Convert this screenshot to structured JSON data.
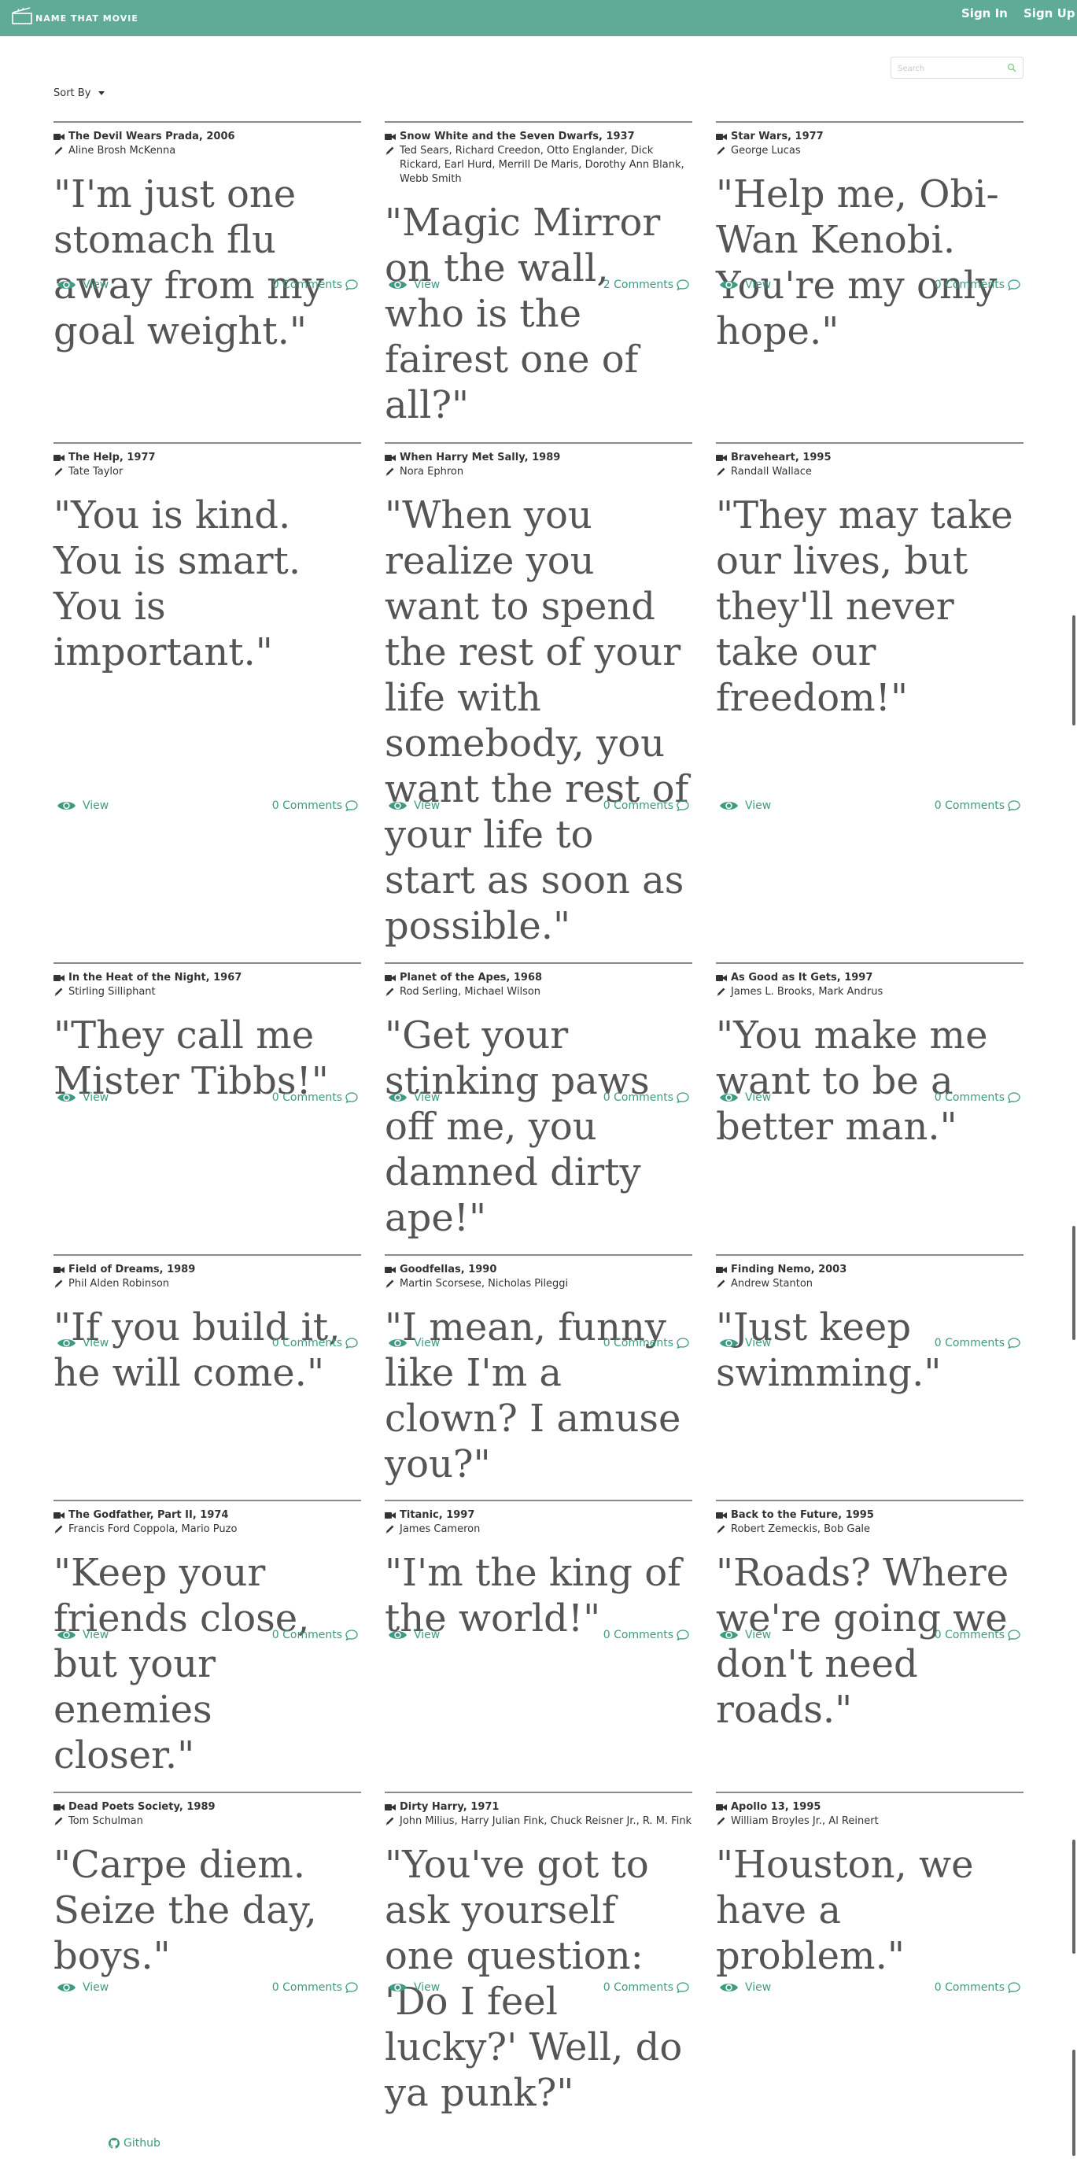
{
  "header": {
    "brand": "NAME THAT MOVIE",
    "sign_in": "Sign In",
    "sign_up": "Sign Up"
  },
  "search": {
    "placeholder": "Search"
  },
  "sort": {
    "label": "Sort By"
  },
  "footer": {
    "github": "Github"
  },
  "colors": {
    "header_bg": "#5fab98",
    "link": "#3e9b82",
    "quote_text": "#555555",
    "divider": "#8a8a8a"
  },
  "movies": [
    {
      "title": "The Devil Wears Prada, 2006",
      "writers": "Aline Brosh McKenna",
      "quote": "\"I'm just one stomach flu away from my goal weight.\"",
      "view": "View",
      "comments": "0 Comments"
    },
    {
      "title": "Snow White and the Seven Dwarfs, 1937",
      "writers": "Ted Sears, Richard Creedon, Otto Englander, Dick Rickard, Earl Hurd, Merrill De Maris, Dorothy Ann Blank, Webb Smith",
      "quote": "\"Magic Mirror on the wall, who is the fairest one of all?\"",
      "view": "View",
      "comments": "2 Comments"
    },
    {
      "title": "Star Wars, 1977",
      "writers": "George Lucas",
      "quote": "\"Help me, Obi-Wan Kenobi. You're my only hope.\"",
      "view": "View",
      "comments": "0 Comments"
    },
    {
      "title": "The Help, 1977",
      "writers": "Tate Taylor",
      "quote": "\"You is kind. You is smart. You is important.\"",
      "view": "View",
      "comments": "0 Comments"
    },
    {
      "title": "When Harry Met Sally, 1989",
      "writers": "Nora Ephron",
      "quote": "\"When you realize you want to spend the rest of your life with somebody, you want the rest of your life to start as soon as possible.\"",
      "view": "View",
      "comments": "0 Comments"
    },
    {
      "title": "Braveheart, 1995",
      "writers": "Randall Wallace",
      "quote": "\"They may take our lives, but they'll never take our freedom!\"",
      "view": "View",
      "comments": "0 Comments"
    },
    {
      "title": "In the Heat of the Night, 1967",
      "writers": "Stirling Silliphant",
      "quote": "\"They call me Mister Tibbs!\"",
      "view": "View",
      "comments": "0 Comments"
    },
    {
      "title": "Planet of the Apes, 1968",
      "writers": "Rod Serling, Michael Wilson",
      "quote": "\"Get your stinking paws off me, you damned dirty ape!\"",
      "view": "View",
      "comments": "0 Comments"
    },
    {
      "title": "As Good as It Gets, 1997",
      "writers": "James L. Brooks, Mark Andrus",
      "quote": "\"You make me want to be a better man.\"",
      "view": "View",
      "comments": "0 Comments"
    },
    {
      "title": "Field of Dreams, 1989",
      "writers": "Phil Alden Robinson",
      "quote": "\"If you build it, he will come.\"",
      "view": "View",
      "comments": "0 Comments"
    },
    {
      "title": "Goodfellas, 1990",
      "writers": "Martin Scorsese, Nicholas Pileggi",
      "quote": "\"I mean, funny like I'm a clown? I amuse you?\"",
      "view": "View",
      "comments": "0 Comments"
    },
    {
      "title": "Finding Nemo, 2003",
      "writers": "Andrew Stanton",
      "quote": "\"Just keep swimming.\"",
      "view": "View",
      "comments": "0 Comments"
    },
    {
      "title": "The Godfather, Part II, 1974",
      "writers": "Francis Ford Coppola, Mario Puzo",
      "quote": "\"Keep your friends close, but your enemies closer.\"",
      "view": "View",
      "comments": "0 Comments"
    },
    {
      "title": "Titanic, 1997",
      "writers": "James Cameron",
      "quote": "\"I'm the king of the world!\"",
      "view": "View",
      "comments": "0 Comments"
    },
    {
      "title": "Back to the Future, 1995",
      "writers": "Robert Zemeckis, Bob Gale",
      "quote": "\"Roads? Where we're going we don't need roads.\"",
      "view": "View",
      "comments": "0 Comments"
    },
    {
      "title": "Dead Poets Society, 1989",
      "writers": "Tom Schulman",
      "quote": "\"Carpe diem. Seize the day, boys.\"",
      "view": "View",
      "comments": "0 Comments"
    },
    {
      "title": "Dirty Harry, 1971",
      "writers": "John Milius, Harry Julian Fink, Chuck Reisner Jr., R. M. Fink",
      "quote": "\"You've got to ask yourself one question: 'Do I feel lucky?' Well, do ya punk?\"",
      "view": "View",
      "comments": "0 Comments"
    },
    {
      "title": "Apollo 13, 1995",
      "writers": "William Broyles Jr., Al Reinert",
      "quote": "\"Houston, we have a problem.\"",
      "view": "View",
      "comments": "0 Comments"
    }
  ]
}
